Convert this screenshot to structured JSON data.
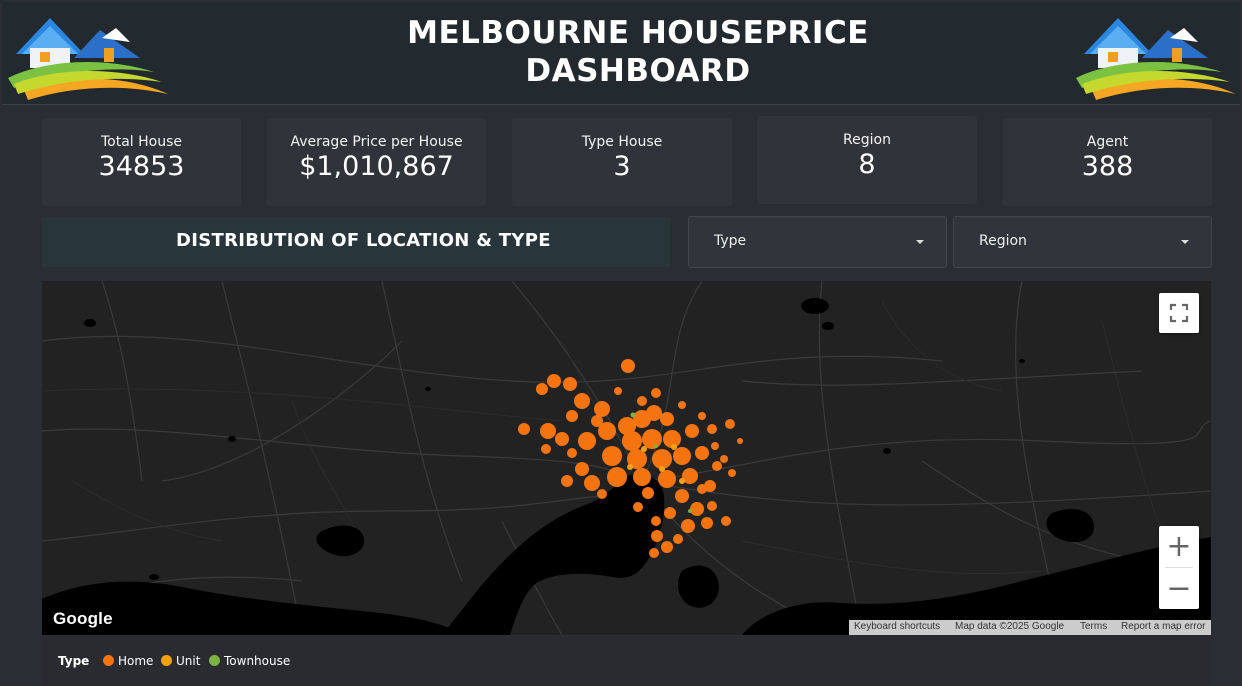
{
  "header": {
    "title_line1": "MELBOURNE HOUSEPRICE",
    "title_line2": "DASHBOARD"
  },
  "kpis": [
    {
      "label": "Total House",
      "value": "34853"
    },
    {
      "label": "Average Price per House",
      "value": "$1,010,867"
    },
    {
      "label": "Type House",
      "value": "3"
    },
    {
      "label": "Region",
      "value": "8"
    },
    {
      "label": "Agent",
      "value": "388"
    }
  ],
  "section": {
    "title": "DISTRIBUTION OF LOCATION & TYPE"
  },
  "filters": {
    "type_label": "Type",
    "region_label": "Region"
  },
  "map": {
    "fullscreen_icon": "fullscreen-icon",
    "zoom_in": "+",
    "zoom_out": "−",
    "provider": "Google",
    "attribution": {
      "shortcuts": "Keyboard shortcuts",
      "map_data": "Map data ©2025 Google",
      "terms": "Terms",
      "report": "Report a map error"
    }
  },
  "legend": {
    "title": "Type",
    "items": [
      {
        "label": "Home",
        "color": "#f5740f"
      },
      {
        "label": "Unit",
        "color": "#f9a10d"
      },
      {
        "label": "Townhouse",
        "color": "#7cb342"
      }
    ]
  },
  "colors": {
    "background": "#2a2d33",
    "card": "#303339",
    "map_land": "#222222",
    "map_water": "#000000",
    "marker_home": "#f5740f"
  }
}
